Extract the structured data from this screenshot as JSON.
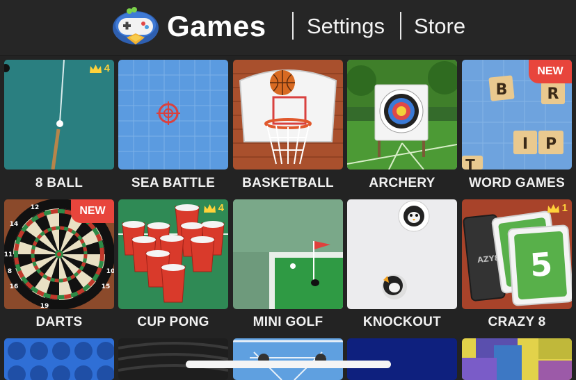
{
  "header": {
    "title": "Games",
    "nav": [
      "Settings",
      "Store"
    ]
  },
  "games": [
    {
      "name": "8 BALL",
      "badge": "crown",
      "crown_count": "4",
      "icon": "pool-table-icon"
    },
    {
      "name": "SEA BATTLE",
      "badge": "",
      "icon": "crosshair-grid-icon"
    },
    {
      "name": "BASKETBALL",
      "badge": "",
      "icon": "basketball-hoop-icon"
    },
    {
      "name": "ARCHERY",
      "badge": "",
      "icon": "archery-target-icon"
    },
    {
      "name": "WORD GAMES",
      "badge": "NEW",
      "icon": "letter-tiles-icon",
      "letters": [
        "B",
        "R",
        "I",
        "P",
        "T"
      ]
    },
    {
      "name": "DARTS",
      "badge": "NEW",
      "icon": "dartboard-icon",
      "dart_numbers": [
        "12",
        "14",
        "11",
        "8",
        "16",
        "19",
        "15",
        "10"
      ]
    },
    {
      "name": "CUP PONG",
      "badge": "crown",
      "crown_count": "4",
      "icon": "red-cups-icon"
    },
    {
      "name": "MINI GOLF",
      "badge": "",
      "icon": "golf-flag-icon"
    },
    {
      "name": "KNOCKOUT",
      "badge": "",
      "icon": "penguin-pucks-icon"
    },
    {
      "name": "CRAZY 8",
      "badge": "crown",
      "crown_count": "1",
      "icon": "cards-icon",
      "card_value": "5",
      "card_back_text": "AZY8"
    }
  ],
  "partial_row": [
    "connect-four-icon",
    "tires-icon",
    "table-game-icon",
    "dark-game-icon",
    "blocks-icon"
  ],
  "colors": {
    "background": "#232323",
    "badge_new": "#e8453c",
    "crown": "#ffd23a"
  }
}
